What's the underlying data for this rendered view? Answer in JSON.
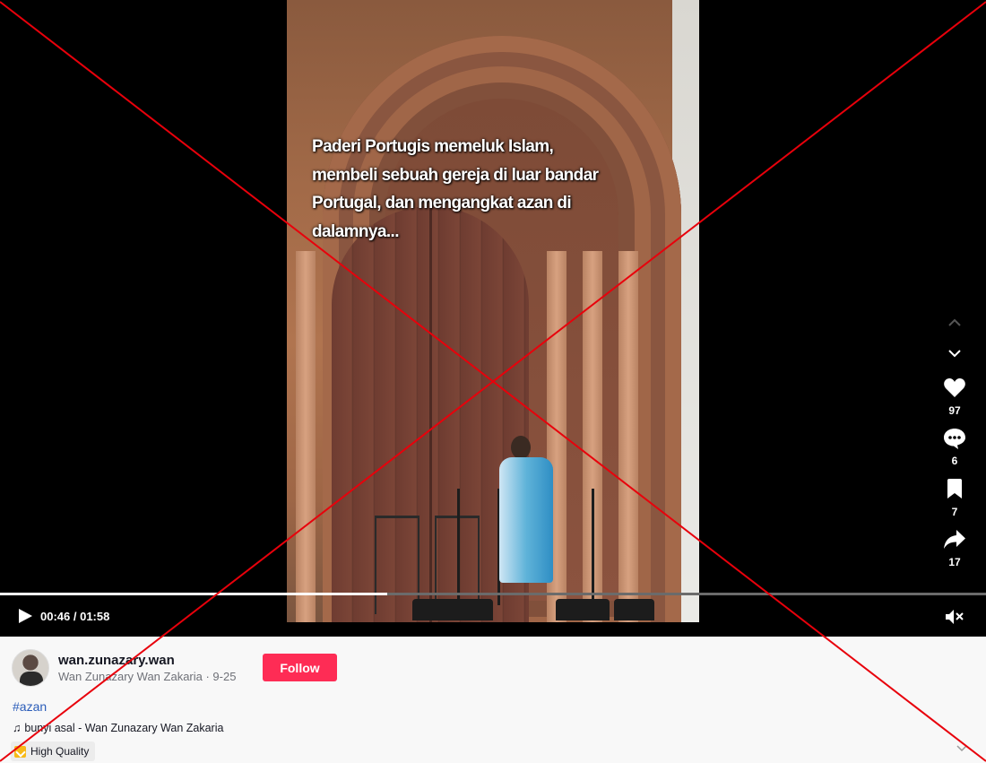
{
  "video": {
    "caption_lines": [
      "Paderi Portugis memeluk Islam,",
      "membeli sebuah gereja di luar bandar",
      "Portugal, dan mengangkat azan di",
      "dalamnya..."
    ],
    "progress_fraction": 0.393
  },
  "actions": {
    "likes": "97",
    "comments": "6",
    "saves": "7",
    "shares": "17"
  },
  "controls": {
    "time": "00:46 / 01:58"
  },
  "post": {
    "username": "wan.zunazary.wan",
    "subline": "Wan Zunazary Wan Zakaria · 9-25",
    "follow_label": "Follow",
    "hashtag": "#azan",
    "music_note": "♫",
    "music": "bunyi asal - Wan Zunazary Wan Zakaria",
    "quality": "High Quality"
  },
  "colors": {
    "follow": "#fe2c55",
    "hashtag": "#2b5db9",
    "overlay_cross": "#e8000b"
  },
  "icons": [
    "chevron-up-icon",
    "chevron-down-icon",
    "heart-icon",
    "comment-icon",
    "bookmark-icon",
    "share-icon",
    "play-icon",
    "mute-icon",
    "quality-icon"
  ]
}
